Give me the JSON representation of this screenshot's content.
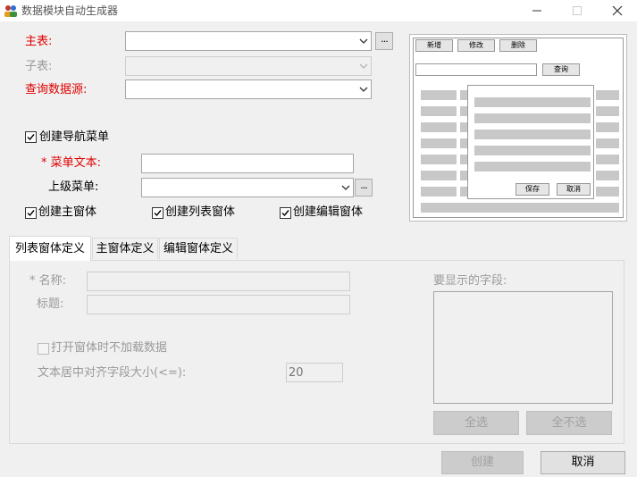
{
  "window": {
    "title": "数据模块自动生成器"
  },
  "form": {
    "master_table_label": "主表:",
    "child_table_label": "子表:",
    "query_source_label": "查询数据源:",
    "create_nav_menu_label": "创建导航菜单",
    "menu_text_label": "* 菜单文本:",
    "parent_menu_label": "上级菜单:",
    "create_main_form_label": "创建主窗体",
    "create_list_form_label": "创建列表窗体",
    "create_edit_form_label": "创建编辑窗体",
    "ellipsis": "..."
  },
  "preview": {
    "new": "新增",
    "edit": "修改",
    "delete": "删除",
    "query": "查询",
    "save": "保存",
    "cancel": "取消"
  },
  "tabs": [
    {
      "label": "列表窗体定义",
      "active": true
    },
    {
      "label": "主窗体定义",
      "active": false
    },
    {
      "label": "编辑窗体定义",
      "active": false
    }
  ],
  "list_tab": {
    "name_label": "* 名称:",
    "title_label": "标题:",
    "no_load_label": "打开窗体时不加载数据",
    "center_align_label": "文本居中对齐字段大小(<=):",
    "center_align_value": "20",
    "fields_label": "要显示的字段:",
    "select_all": "全选",
    "select_none": "全不选"
  },
  "footer": {
    "create": "创建",
    "cancel": "取消"
  },
  "colors": {
    "required_label": "#e00000",
    "disabled_text": "#9a9a9a"
  }
}
